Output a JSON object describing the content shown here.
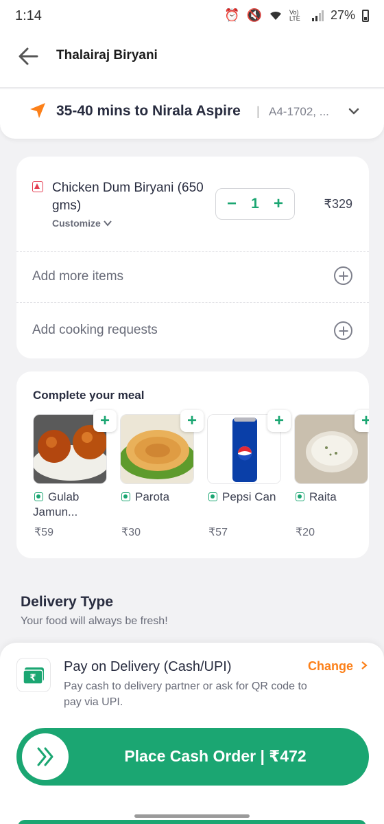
{
  "status_bar": {
    "time": "1:14",
    "battery": "27%",
    "network": "Vo) LTE"
  },
  "header": {
    "title": "Thalairaj Biryani"
  },
  "address": {
    "eta": "35-40 mins to Nirala Aspire",
    "separator": "|",
    "detail": "A4-1702, ..."
  },
  "cart_item": {
    "name": "Chicken Dum Biryani (650 gms)",
    "customize_label": "Customize",
    "quantity": "1",
    "minus": "−",
    "plus": "+",
    "price": "₹329"
  },
  "actions": {
    "add_more": "Add more items",
    "cooking_requests": "Add cooking requests"
  },
  "meal": {
    "title": "Complete your meal",
    "add_symbol": "+",
    "items": [
      {
        "name": "Gulab Jamun...",
        "price": "₹59"
      },
      {
        "name": "Parota",
        "price": "₹30"
      },
      {
        "name": "Pepsi Can",
        "price": "₹57"
      },
      {
        "name": "Raita",
        "price": "₹20"
      }
    ]
  },
  "delivery": {
    "title": "Delivery Type",
    "subtitle": "Your food will always be fresh!"
  },
  "payment": {
    "title": "Pay on Delivery (Cash/UPI)",
    "change_label": "Change",
    "description": "Pay cash to delivery partner or ask for QR code to pay via UPI.",
    "icon_symbol": "₹"
  },
  "place_order": {
    "label": "Place Cash Order | ₹472"
  },
  "colors": {
    "accent": "#fc8019",
    "green": "#1ba672",
    "nonveg": "#e43b4f"
  }
}
